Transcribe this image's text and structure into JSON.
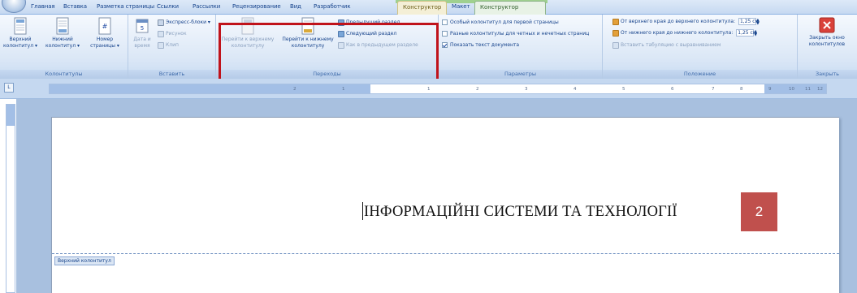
{
  "tabs": [
    {
      "label": "Главная"
    },
    {
      "label": "Вставка"
    },
    {
      "label": "Разметка страницы"
    },
    {
      "label": "Ссылки"
    },
    {
      "label": "Рассылки"
    },
    {
      "label": "Рецензирование"
    },
    {
      "label": "Вид"
    },
    {
      "label": "Разработчик"
    },
    {
      "label": "Конструктор"
    },
    {
      "label": "Макет"
    }
  ],
  "active_tab": "Конструктор",
  "groups": {
    "headers": {
      "label": "Колонтитулы",
      "header_btn": "Верхний\nколонтитул ▾",
      "footer_btn": "Нижний\nколонтитул ▾",
      "page_number_btn": "Номер\nстраницы ▾"
    },
    "insert": {
      "label": "Вставить",
      "date_btn": "Дата и\nвремя",
      "express_blocks": "Экспресс-блоки ▾",
      "picture": "Рисунок",
      "clip": "Клип"
    },
    "navigation": {
      "label": "Переходы",
      "goto_header": "Перейти к верхнему\nколонтитулу",
      "goto_footer": "Перейти к нижнему\nколонтитулу",
      "prev_section": "Предыдущий раздел",
      "next_section": "Следующий раздел",
      "link_prev": "Как в предыдущем разделе"
    },
    "options": {
      "label": "Параметры",
      "first_page": "Особый колонтитул для первой страницы",
      "odd_even": "Разные колонтитулы для четных и нечетных страниц",
      "show_text": "Показать текст документа",
      "show_text_checked": true
    },
    "position": {
      "label": "Положение",
      "header_top_label": "От верхнего края до верхнего колонтитула:",
      "header_top_value": "1,25 см",
      "footer_bottom_label": "От нижнего края до нижнего колонтитула:",
      "footer_bottom_value": "1,25 см",
      "insert_tab": "Вставить табуляцию с выравниванием"
    },
    "close": {
      "label": "Закрыть",
      "close_btn": "Закрыть окно\nколонтитулов"
    }
  },
  "ruler": {
    "ticks": [
      "2",
      "1",
      "1",
      "2",
      "3",
      "4",
      "5",
      "6",
      "7",
      "8",
      "9",
      "10",
      "11",
      "12"
    ]
  },
  "document": {
    "header_text": "ІНФОРМАЦІЙНІ СИСТЕМИ ТА ТЕХНОЛОГІЇ",
    "page_number": "2",
    "header_tag": "Верхний колонтитул"
  },
  "colors": {
    "highlight": "#c0131b",
    "page_number_bg": "#c0504d",
    "ribbon_text": "#15428b"
  }
}
